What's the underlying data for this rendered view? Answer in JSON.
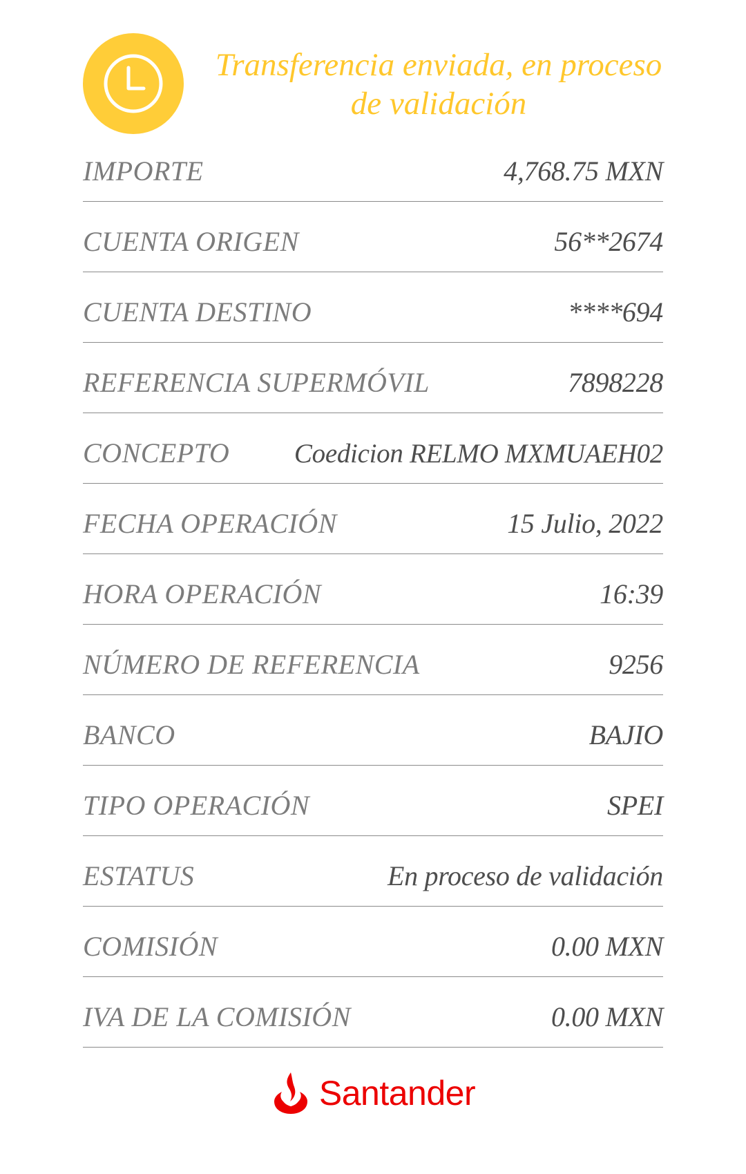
{
  "header": {
    "title": "Transferencia enviada, en proceso de validación",
    "icon": "clock-icon",
    "accent_color": "#ffcd38"
  },
  "details": [
    {
      "label": "IMPORTE",
      "value": "4,768.75 MXN"
    },
    {
      "label": "CUENTA ORIGEN",
      "value": "56**2674"
    },
    {
      "label": "CUENTA DESTINO",
      "value": "****694"
    },
    {
      "label": "REFERENCIA SUPERMÓVIL",
      "value": "7898228"
    },
    {
      "label": "CONCEPTO",
      "value": "Coedicion RELMO MXMUAEH02"
    },
    {
      "label": "FECHA OPERACIÓN",
      "value": "15 Julio, 2022"
    },
    {
      "label": "HORA OPERACIÓN",
      "value": "16:39"
    },
    {
      "label": "NÚMERO DE REFERENCIA",
      "value": "9256"
    },
    {
      "label": "BANCO",
      "value": "BAJIO"
    },
    {
      "label": "TIPO OPERACIÓN",
      "value": "SPEI"
    },
    {
      "label": "ESTATUS",
      "value": "En proceso de validación"
    },
    {
      "label": "COMISIÓN",
      "value": "0.00 MXN"
    },
    {
      "label": "IVA DE LA COMISIÓN",
      "value": "0.00 MXN"
    }
  ],
  "brand": {
    "name": "Santander",
    "icon": "santander-flame-icon",
    "color": "#ec0000"
  }
}
